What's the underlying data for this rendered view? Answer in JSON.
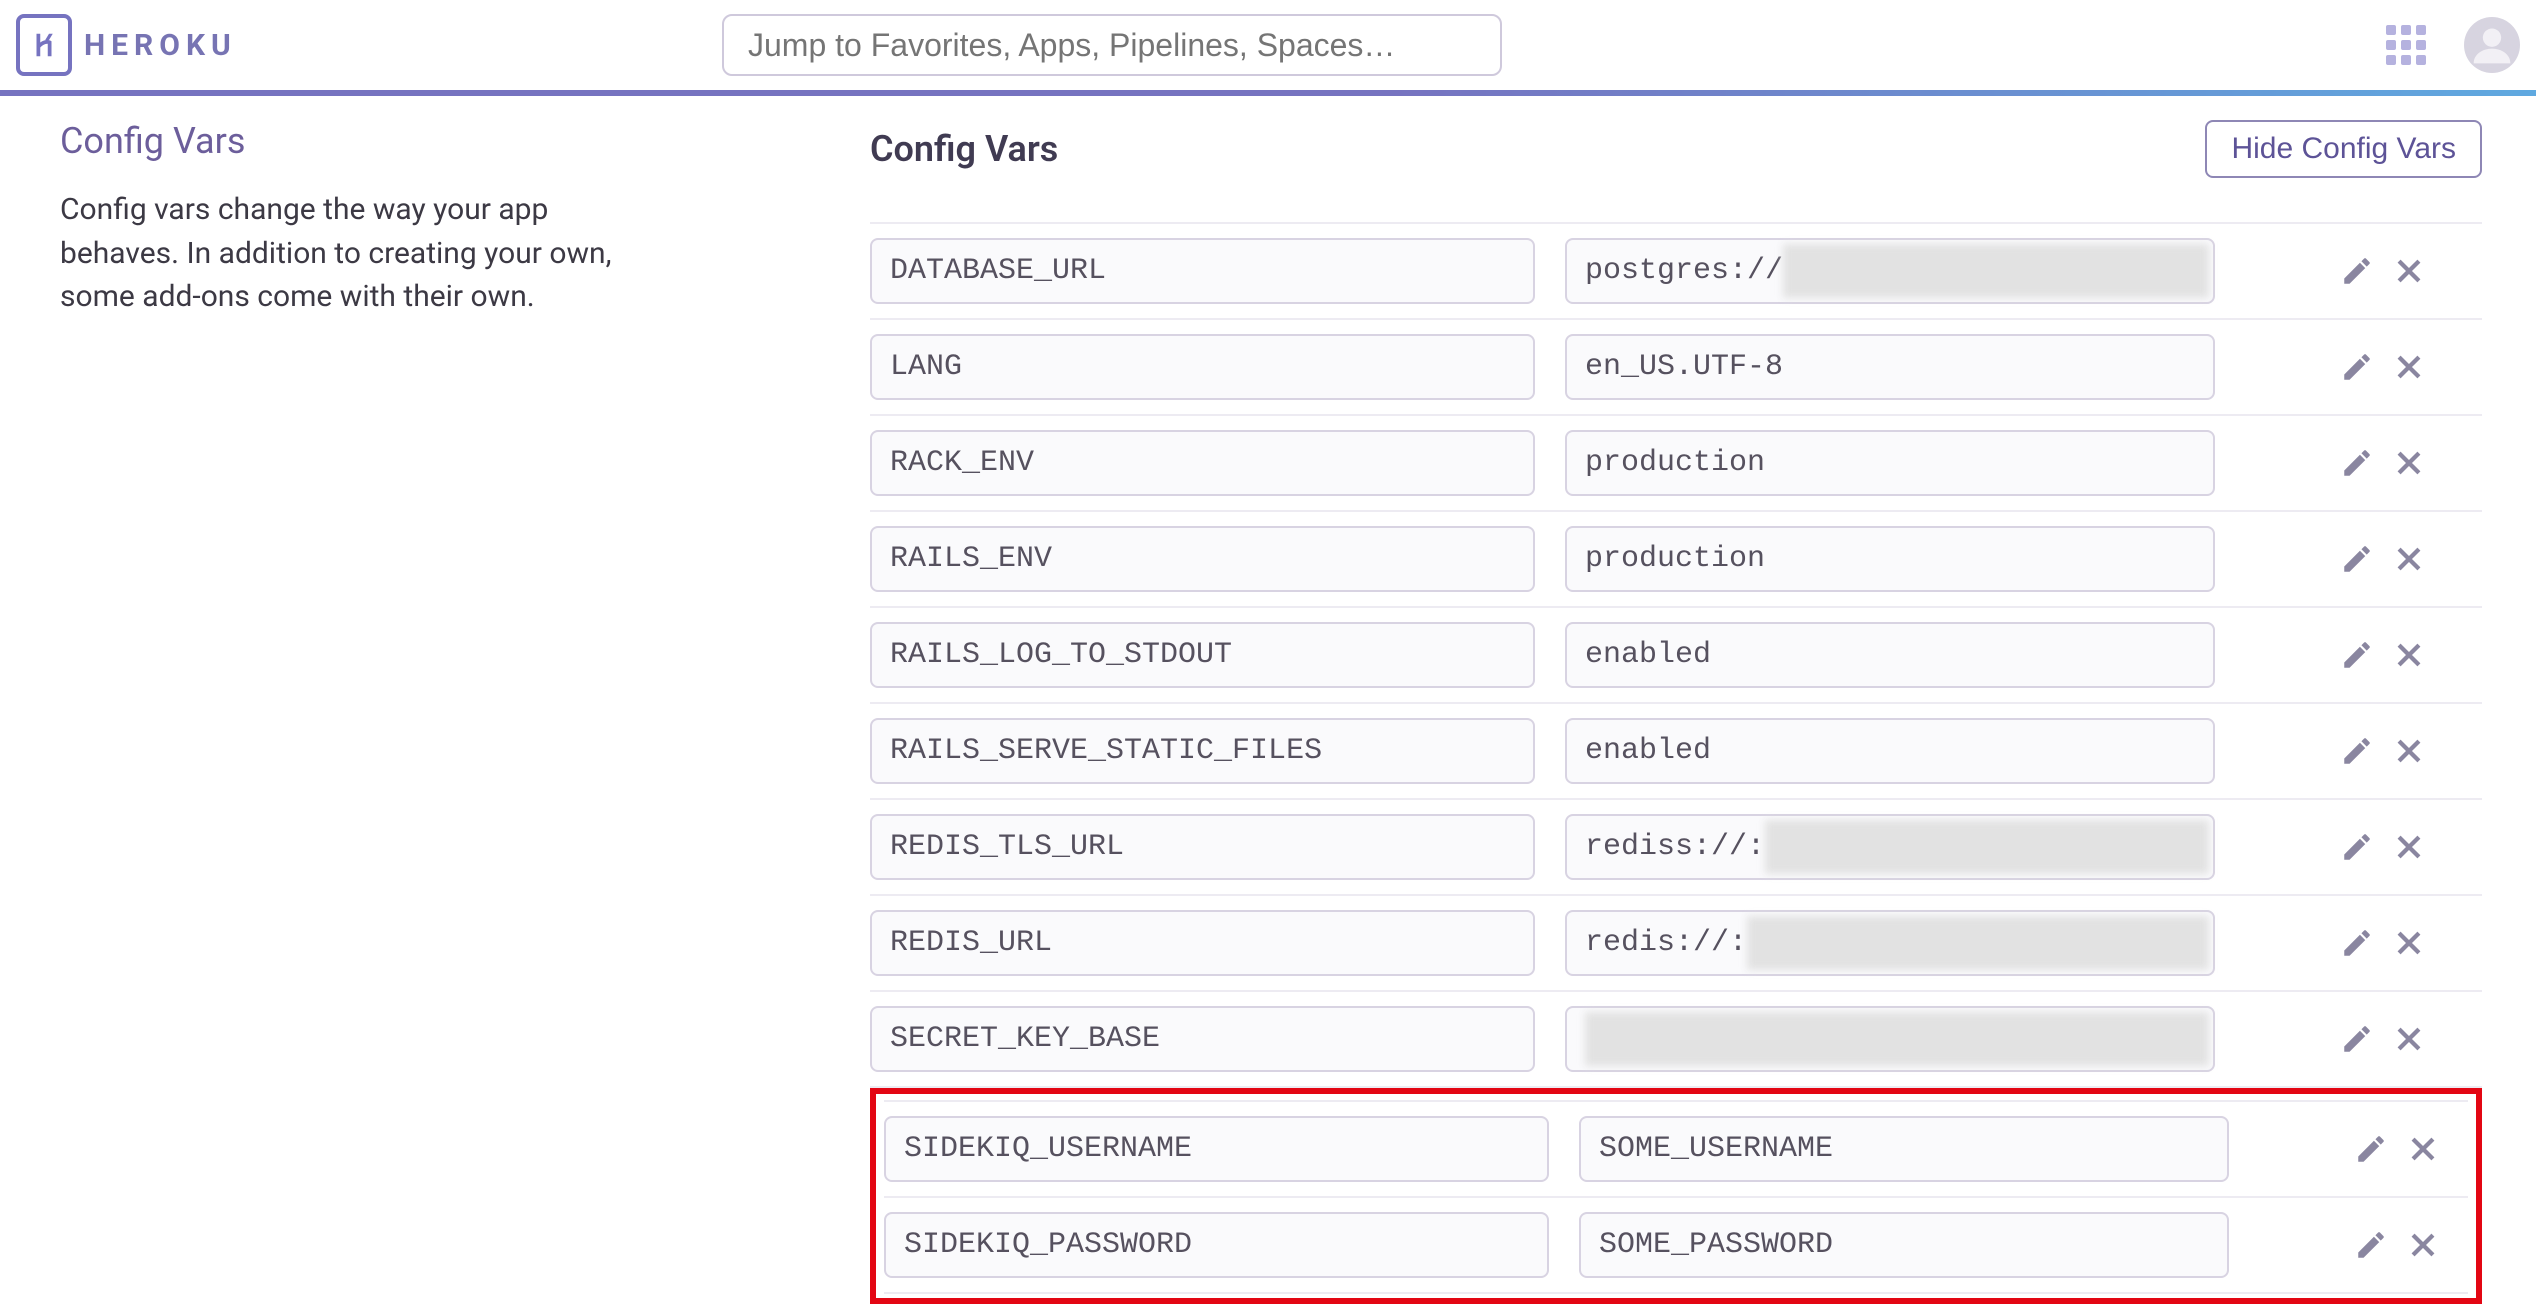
{
  "header": {
    "brand": "HEROKU",
    "search_placeholder": "Jump to Favorites, Apps, Pipelines, Spaces…"
  },
  "sidebar": {
    "title": "Config Vars",
    "description": "Config vars change the way your app behaves. In addition to creating your own, some add-ons come with their own."
  },
  "main": {
    "title": "Config Vars",
    "hide_button_label": "Hide Config Vars"
  },
  "config_vars": [
    {
      "key": "DATABASE_URL",
      "value": "postgres://",
      "redacted": true,
      "highlighted": false
    },
    {
      "key": "LANG",
      "value": "en_US.UTF-8",
      "redacted": false,
      "highlighted": false
    },
    {
      "key": "RACK_ENV",
      "value": "production",
      "redacted": false,
      "highlighted": false
    },
    {
      "key": "RAILS_ENV",
      "value": "production",
      "redacted": false,
      "highlighted": false
    },
    {
      "key": "RAILS_LOG_TO_STDOUT",
      "value": "enabled",
      "redacted": false,
      "highlighted": false
    },
    {
      "key": "RAILS_SERVE_STATIC_FILES",
      "value": "enabled",
      "redacted": false,
      "highlighted": false
    },
    {
      "key": "REDIS_TLS_URL",
      "value": "rediss://:",
      "redacted": true,
      "highlighted": false
    },
    {
      "key": "REDIS_URL",
      "value": "redis://:",
      "redacted": true,
      "highlighted": false
    },
    {
      "key": "SECRET_KEY_BASE",
      "value": "",
      "redacted": true,
      "highlighted": false
    },
    {
      "key": "SIDEKIQ_USERNAME",
      "value": "SOME_USERNAME",
      "redacted": false,
      "highlighted": true
    },
    {
      "key": "SIDEKIQ_PASSWORD",
      "value": "SOME_PASSWORD",
      "redacted": false,
      "highlighted": true
    }
  ]
}
